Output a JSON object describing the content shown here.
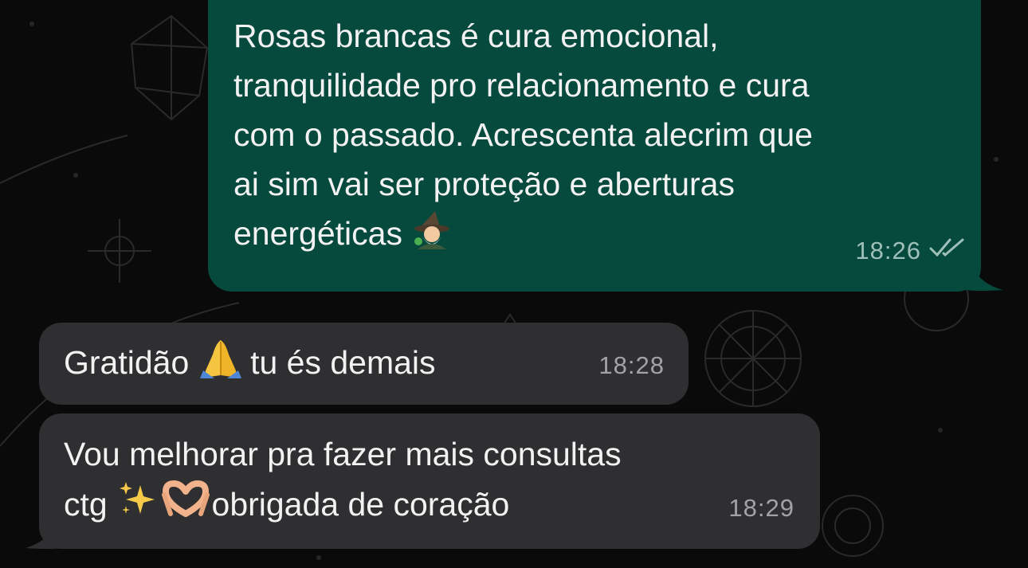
{
  "messages": [
    {
      "direction": "outgoing",
      "text": "Rosas brancas é cura emocional,\ntranquilidade pro relacionamento e cura\ncom o passado. Acrescenta alecrim que\nai sim vai ser proteção e aberturas\nenergéticas",
      "emoji_after": "mage-emoji",
      "time": "18:26",
      "status": "read-double-check"
    },
    {
      "direction": "incoming",
      "text_before": "Gratidão",
      "emoji": "folded-hands-emoji",
      "text_after": "tu és demais",
      "time": "18:28"
    },
    {
      "direction": "incoming",
      "line1": "Vou melhorar pra fazer mais consultas",
      "line2_before": "ctg",
      "emojis": [
        "sparkles-emoji",
        "heart-hands-emoji"
      ],
      "line2_after": "obrigada de coração",
      "time": "18:29"
    }
  ],
  "colors": {
    "outgoing_bubble": "#06493d",
    "incoming_bubble": "#2f2f31",
    "background": "#0a0a0a",
    "text": "#f2f2f2"
  }
}
